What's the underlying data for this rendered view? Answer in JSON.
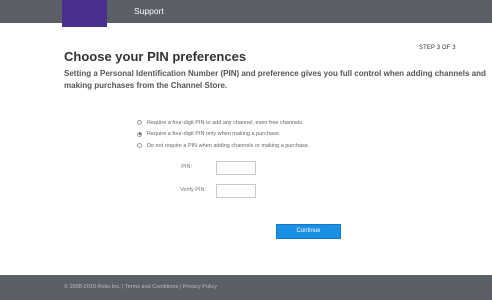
{
  "header": {
    "nav_support": "Support"
  },
  "page": {
    "step": "STEP 3 OF 3",
    "title": "Choose your PIN preferences",
    "description": "Setting a Personal Identification Number (PIN) and preference gives you full control when adding channels and making purchases from the Channel Store."
  },
  "pin_options": [
    {
      "label": "Require a four-digit PIN to add any channel, even free channels.",
      "selected": false
    },
    {
      "label": "Require a four-digit PIN only when making a purchase.",
      "selected": true
    },
    {
      "label": "Do not require a PIN when adding channels or making a purchase.",
      "selected": false
    }
  ],
  "form": {
    "pin_label": "PIN:",
    "pin_value": "",
    "verify_label": "Verify PIN:",
    "verify_value": ""
  },
  "actions": {
    "continue_label": "Continue"
  },
  "footer": {
    "copyright": "© 2008-2010 Roku Inc.",
    "sep1": " | ",
    "terms": "Terms and Conditions",
    "sep2": " | ",
    "privacy": "Privacy Policy"
  },
  "colors": {
    "header_bg": "#5b5f68",
    "logo_block": "#4d2f8f",
    "continue_button": "#1a8fe6"
  }
}
